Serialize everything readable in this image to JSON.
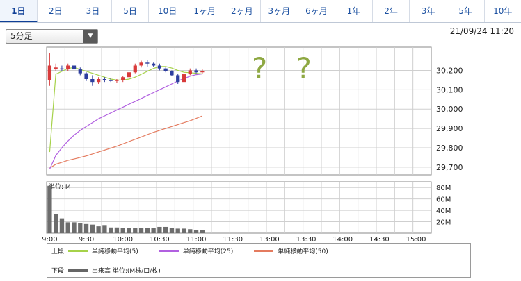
{
  "tabs": [
    {
      "label": "1日",
      "active": true
    },
    {
      "label": "2日"
    },
    {
      "label": "3日"
    },
    {
      "label": "5日"
    },
    {
      "label": "10日"
    },
    {
      "label": "1ヶ月"
    },
    {
      "label": "2ヶ月"
    },
    {
      "label": "3ヶ月"
    },
    {
      "label": "6ヶ月"
    },
    {
      "label": "1年"
    },
    {
      "label": "2年"
    },
    {
      "label": "3年"
    },
    {
      "label": "5年"
    },
    {
      "label": "10年"
    }
  ],
  "interval_select": {
    "value": "5分足"
  },
  "timestamp": "21/09/24 11:20",
  "annotation": "? ?",
  "colors": {
    "up": "#d83a3a",
    "down": "#2d3e9e",
    "ma5": "#a6d24a",
    "ma25": "#b160e0",
    "ma50": "#e47b5f",
    "volume": "#6d6d6d",
    "grid": "#cfcfcf",
    "annotation": "#8ea842"
  },
  "chart_data": [
    {
      "type": "candlestick",
      "interval": "5 min",
      "y_ticks": [
        "30,200",
        "30,100",
        "30,000",
        "29,900",
        "29,800",
        "29,700"
      ],
      "ylim": [
        29660,
        30320
      ],
      "x_ticks": [
        "9:00",
        "9:30",
        "10:00",
        "10:30",
        "11:00",
        "11:30",
        "13:00",
        "13:30",
        "14:00",
        "14:30",
        "15:00"
      ],
      "x_tick_slots": [
        0,
        6,
        12,
        18,
        24,
        30,
        36,
        42,
        48,
        54,
        60
      ],
      "slots": 63,
      "candles": [
        {
          "o": 30150,
          "h": 30290,
          "l": 30120,
          "c": 30225
        },
        {
          "o": 30205,
          "h": 30235,
          "l": 30195,
          "c": 30215
        },
        {
          "o": 30210,
          "h": 30225,
          "l": 30195,
          "c": 30205
        },
        {
          "o": 30205,
          "h": 30235,
          "l": 30195,
          "c": 30225
        },
        {
          "o": 30225,
          "h": 30240,
          "l": 30200,
          "c": 30205
        },
        {
          "o": 30205,
          "h": 30215,
          "l": 30175,
          "c": 30185
        },
        {
          "o": 30185,
          "h": 30190,
          "l": 30145,
          "c": 30155
        },
        {
          "o": 30155,
          "h": 30175,
          "l": 30120,
          "c": 30140
        },
        {
          "o": 30140,
          "h": 30165,
          "l": 30130,
          "c": 30155
        },
        {
          "o": 30155,
          "h": 30165,
          "l": 30140,
          "c": 30150
        },
        {
          "o": 30150,
          "h": 30160,
          "l": 30140,
          "c": 30145
        },
        {
          "o": 30145,
          "h": 30155,
          "l": 30135,
          "c": 30150
        },
        {
          "o": 30150,
          "h": 30170,
          "l": 30140,
          "c": 30165
        },
        {
          "o": 30165,
          "h": 30195,
          "l": 30160,
          "c": 30190
        },
        {
          "o": 30190,
          "h": 30235,
          "l": 30185,
          "c": 30225
        },
        {
          "o": 30225,
          "h": 30250,
          "l": 30215,
          "c": 30240
        },
        {
          "o": 30240,
          "h": 30255,
          "l": 30220,
          "c": 30235
        },
        {
          "o": 30235,
          "h": 30240,
          "l": 30220,
          "c": 30225
        },
        {
          "o": 30225,
          "h": 30235,
          "l": 30200,
          "c": 30210
        },
        {
          "o": 30210,
          "h": 30215,
          "l": 30190,
          "c": 30195
        },
        {
          "o": 30195,
          "h": 30200,
          "l": 30170,
          "c": 30175
        },
        {
          "o": 30175,
          "h": 30180,
          "l": 30130,
          "c": 30140
        },
        {
          "o": 30140,
          "h": 30190,
          "l": 30130,
          "c": 30180
        },
        {
          "o": 30180,
          "h": 30210,
          "l": 30175,
          "c": 30200
        },
        {
          "o": 30200,
          "h": 30210,
          "l": 30185,
          "c": 30190
        },
        {
          "o": 30190,
          "h": 30205,
          "l": 30180,
          "c": 30195
        }
      ],
      "ma5": [
        29778,
        30180,
        30195,
        30210,
        30215,
        30205,
        30195,
        30185,
        30175,
        30165,
        30155,
        30150,
        30150,
        30155,
        30165,
        30180,
        30195,
        30210,
        30220,
        30220,
        30212,
        30200,
        30190,
        30188,
        30185,
        30182
      ],
      "ma25": [
        29690,
        29760,
        29800,
        29835,
        29865,
        29890,
        29910,
        29930,
        29950,
        29965,
        29980,
        29995,
        30010,
        30025,
        30040,
        30055,
        30070,
        30085,
        30100,
        30115,
        30130,
        30145,
        30158,
        30170,
        30178,
        30182
      ],
      "ma50": [
        29695,
        29715,
        29725,
        29735,
        29742,
        29750,
        29758,
        29768,
        29778,
        29788,
        29798,
        29808,
        29820,
        29832,
        29844,
        29856,
        29868,
        29880,
        29890,
        29900,
        29910,
        29920,
        29930,
        29940,
        29952,
        29965
      ]
    },
    {
      "type": "bar",
      "title": "単位: M",
      "y_ticks": [
        "80M",
        "60M",
        "40M",
        "20M"
      ],
      "ylim": [
        0,
        90
      ],
      "values": [
        83,
        34,
        26,
        19,
        19,
        17,
        16,
        15,
        12,
        13,
        10,
        10,
        9,
        9,
        9,
        9,
        9,
        9,
        11,
        11,
        9,
        8,
        8,
        7,
        6,
        5
      ]
    }
  ],
  "legend": {
    "upper_label": "上段:",
    "lower_label": "下段:",
    "ma5": "単純移動平均(5)",
    "ma25": "単純移動平均(25)",
    "ma50": "単純移動平均(50)",
    "volume": "出来高 単位:(M株/口/枚)"
  }
}
